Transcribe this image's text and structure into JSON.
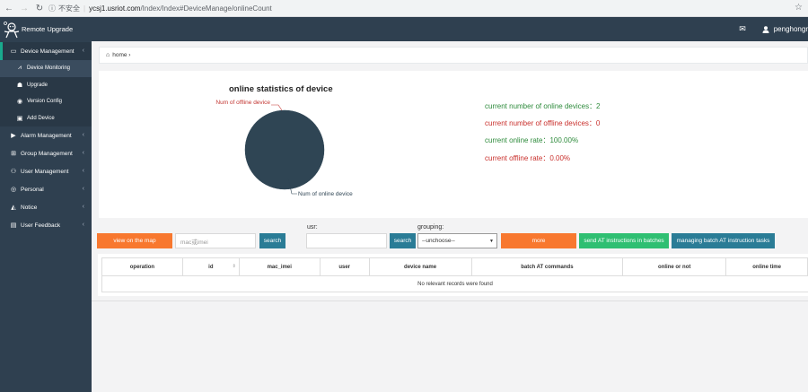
{
  "browser": {
    "insecure_label": "不安全",
    "url_host": "ycsj1.usriot.com",
    "url_path": "/Index/Index#DeviceManage/onlineCount"
  },
  "header": {
    "brand": "Remote Upgrade",
    "username": "penghongr"
  },
  "sidebar": {
    "items": [
      {
        "label": "Device Management",
        "icon": "laptop-icon"
      },
      {
        "label": "Alarm Management",
        "icon": "video-icon"
      },
      {
        "label": "Group Management",
        "icon": "sitemap-icon"
      },
      {
        "label": "User Management",
        "icon": "users-icon"
      },
      {
        "label": "Personal",
        "icon": "user-circle-icon"
      },
      {
        "label": "Notice",
        "icon": "bell-icon"
      },
      {
        "label": "User Feedback",
        "icon": "comment-icon"
      }
    ],
    "sub_items": [
      {
        "label": "Device Monitoring",
        "icon": "line-chart-icon"
      },
      {
        "label": "Upgrade",
        "icon": "user-gear-icon"
      },
      {
        "label": "Version Config",
        "icon": "compass-icon"
      },
      {
        "label": "Add Device",
        "icon": "group-icon"
      }
    ]
  },
  "breadcrumb": {
    "home": "home ›"
  },
  "stats": {
    "chart_title": "online statistics of device",
    "lines": [
      "current number of online devices：2",
      "current number of offline devices：0",
      "current online rate：100.00%",
      "current offline rate：0.00%"
    ],
    "colors": {
      "online": "#2e8b3c",
      "offline": "#c9302c"
    }
  },
  "chart_data": {
    "type": "pie",
    "title": "online statistics of device",
    "slices": [
      {
        "label": "Num of offline device",
        "value": 0
      },
      {
        "label": "Num of online device",
        "value": 2
      }
    ],
    "colors": [
      "#c23531",
      "#2f4554"
    ]
  },
  "toolbar": {
    "map_button": "view on the map",
    "mac_placeholder": "mac或imei",
    "search1": "search",
    "usr_label": "usr:",
    "search2": "search",
    "grouping_label": "grouping:",
    "grouping_selected": "--unchoose--",
    "more_button": "more",
    "send_at_button": "send AT instructions in batches",
    "manage_at_button": "managing batch AT instruction tasks"
  },
  "table": {
    "columns": [
      "operation",
      "id",
      "mac_imei",
      "user",
      "device name",
      "batch AT commands",
      "online or not",
      "online time"
    ],
    "empty_message": "No relevant records were found"
  }
}
